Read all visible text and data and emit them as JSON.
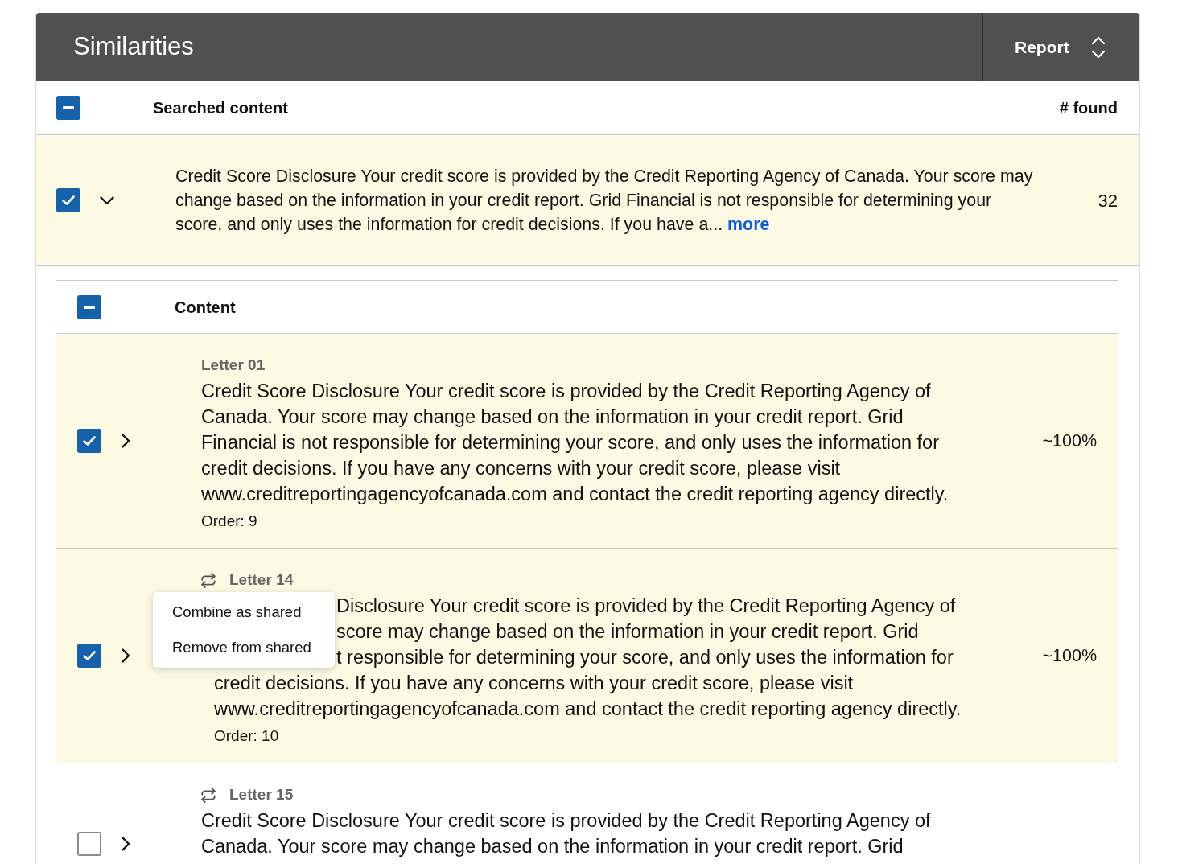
{
  "header": {
    "title": "Similarities",
    "report_select": {
      "value": "Report"
    }
  },
  "searched": {
    "select_all": {
      "indeterminate": true
    },
    "columns": [
      "Searched content",
      "# found"
    ],
    "rows": [
      {
        "checked": true,
        "expanded": true,
        "lines": [
          "Credit Score Disclosure Your credit score is provided by the Credit Reporting Agency of Canada. Your score may",
          "change based on the information in your credit report. Grid Financial is not responsible for determining your",
          "score, and only uses the information for credit decisions. If you have a..."
        ],
        "more_link": "more",
        "found": "32"
      }
    ]
  },
  "content": {
    "select_all": {
      "indeterminate": true
    },
    "columns": [
      "Content"
    ],
    "rows": [
      {
        "title": "Letter 01",
        "shared": false,
        "checked": true,
        "expanded": false,
        "lines": [
          "Credit Score Disclosure Your credit score is provided by the Credit Reporting Agency of",
          "Canada. Your score may change based on the information in your credit report. Grid",
          "Financial is not responsible for determining your score, and only uses the information for",
          "credit decisions. If you have any concerns with your credit score, please visit",
          "www.creditreportingagencyofcanada.com and contact the credit reporting agency directly."
        ],
        "order": "Order: 9",
        "match": "~100%"
      },
      {
        "title": "Letter 14",
        "shared": true,
        "checked": true,
        "expanded": false,
        "partial_lines": [
          "Disclosure Your credit score is provided by the Credit Reporting Agency of",
          "score may change based on the information in your credit report. Grid",
          "t responsible for determining your score, and only uses the information for"
        ],
        "lines": [
          "credit decisions. If you have any concerns with your credit score, please visit",
          "www.creditreportingagencyofcanada.com and contact the credit reporting agency directly."
        ],
        "order": "Order: 10",
        "match": "~100%",
        "context_menu": {
          "items": [
            "Combine as shared",
            "Remove from shared"
          ]
        }
      },
      {
        "title": "Letter 15",
        "shared": true,
        "checked": false,
        "expanded": false,
        "lines": [
          "Credit Score Disclosure Your credit score is provided by the Credit Reporting Agency of",
          "Canada. Your score may change based on the information in your credit report. Grid"
        ]
      }
    ]
  }
}
